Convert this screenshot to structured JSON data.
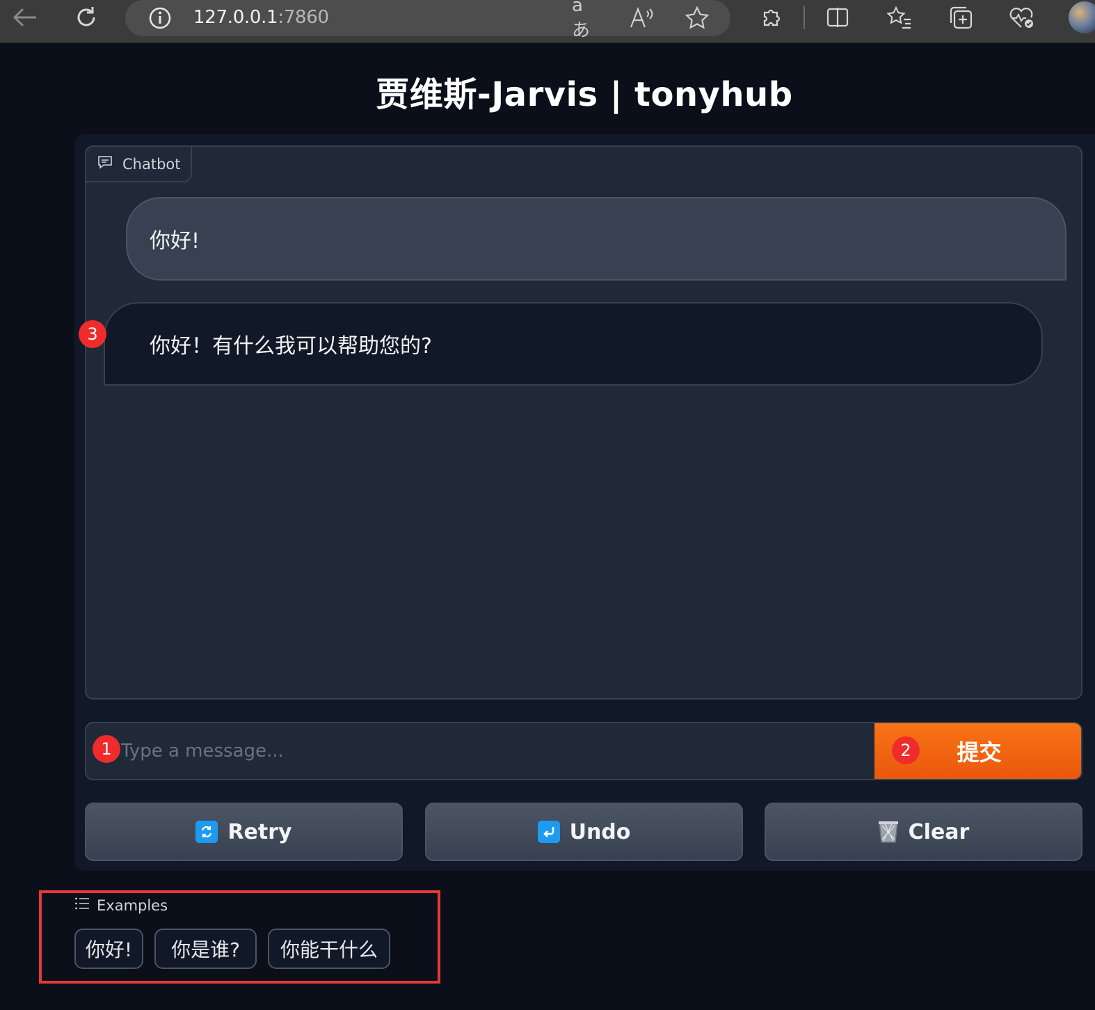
{
  "browser": {
    "url_host": "127.0.0.1",
    "url_port": ":7860"
  },
  "app": {
    "title": "贾维斯-Jarvis | tonyhub"
  },
  "chatbot": {
    "label": "Chatbot",
    "messages": [
      {
        "role": "user",
        "text": "你好!"
      },
      {
        "role": "assistant",
        "text": "你好！有什么我可以帮助您的?"
      }
    ]
  },
  "input": {
    "placeholder": "Type a message...",
    "submit_label": "提交"
  },
  "actions": {
    "retry_label": "Retry",
    "undo_label": "Undo",
    "clear_label": "Clear"
  },
  "examples": {
    "label": "Examples",
    "items": [
      "你好!",
      "你是谁?",
      "你能干什么"
    ]
  },
  "annotations": {
    "badge_1": "1",
    "badge_2": "2",
    "badge_3": "3"
  },
  "colors": {
    "accent": "#f97316",
    "badge": "#ee2c2c",
    "highlight_frame": "#e53935",
    "background": "#0b0f19"
  }
}
